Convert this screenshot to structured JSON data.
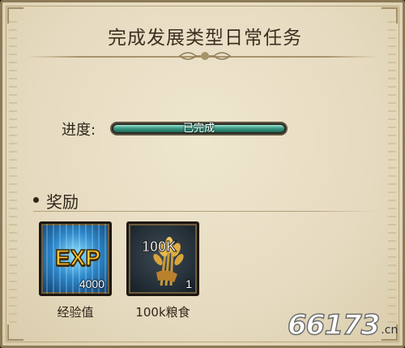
{
  "dialog": {
    "title": "完成发展类型日常任务"
  },
  "progress": {
    "label": "进度:",
    "status_text": "已完成",
    "fraction": 1.0
  },
  "rewards": {
    "heading": "奖励",
    "items": [
      {
        "icon": "exp-icon",
        "icon_text": "EXP",
        "count": "4000",
        "name": "经验值"
      },
      {
        "icon": "grain-icon",
        "icon_text": "100K",
        "count": "1",
        "name": "100k粮食"
      }
    ]
  },
  "watermark": {
    "main": "66173",
    "suffix": ".cn"
  },
  "colors": {
    "parchment": "#e6dbc0",
    "frame": "#8c7a57",
    "progress_fill": "#3c9c86",
    "exp_gold": "#f4c430"
  }
}
